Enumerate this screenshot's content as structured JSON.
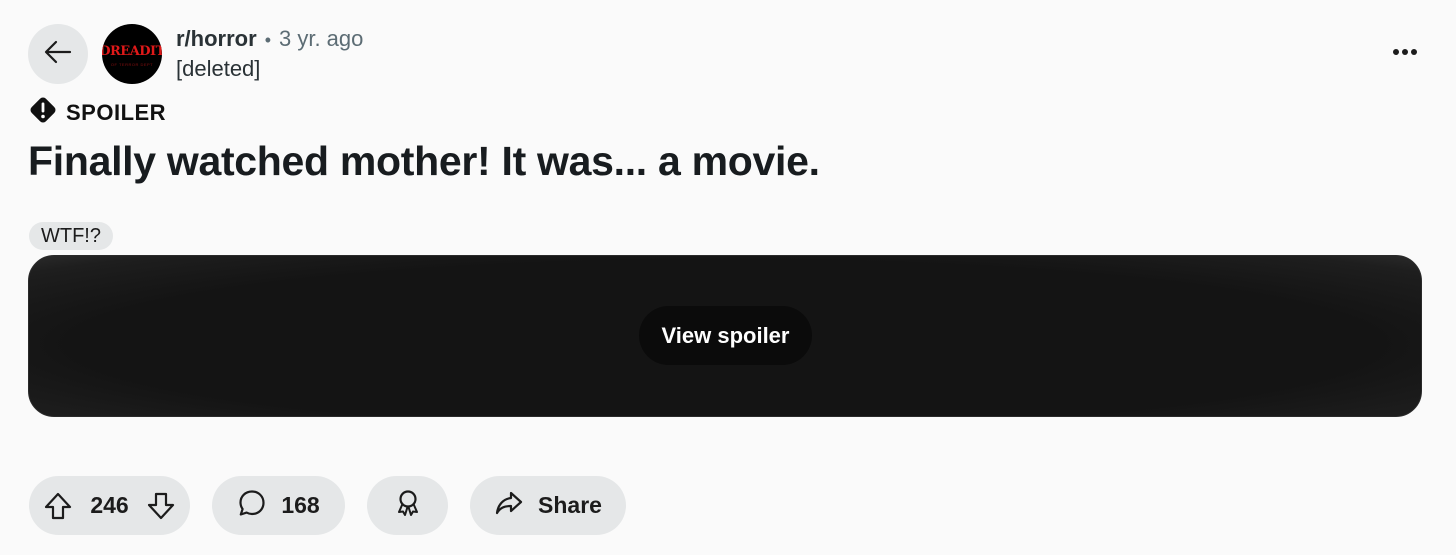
{
  "post": {
    "subreddit": "r/horror",
    "separator": "•",
    "age": "3 yr. ago",
    "author": "[deleted]",
    "spoiler_label": "SPOILER",
    "title": "Finally watched mother! It was... a movie.",
    "flair": "WTF!?",
    "view_spoiler_label": "View spoiler"
  },
  "avatar": {
    "logo_text": "DREADIT",
    "logo_subtext": "OF TERROR DEPT",
    "logo_color": "#e01919"
  },
  "actions": {
    "votes": "246",
    "comments": "168",
    "share_label": "Share"
  },
  "icons": {
    "back": "arrow-left-icon",
    "more": "more-horizontal-icon",
    "spoiler": "spoiler-warning-icon",
    "upvote": "upvote-arrow-icon",
    "downvote": "downvote-arrow-icon",
    "comment": "comment-bubble-icon",
    "award": "award-icon",
    "share": "share-arrow-icon"
  },
  "colors": {
    "background": "#fafafa",
    "pill_bg": "#e5e7e8",
    "spoiler_button_bg": "#0b0b0b"
  }
}
